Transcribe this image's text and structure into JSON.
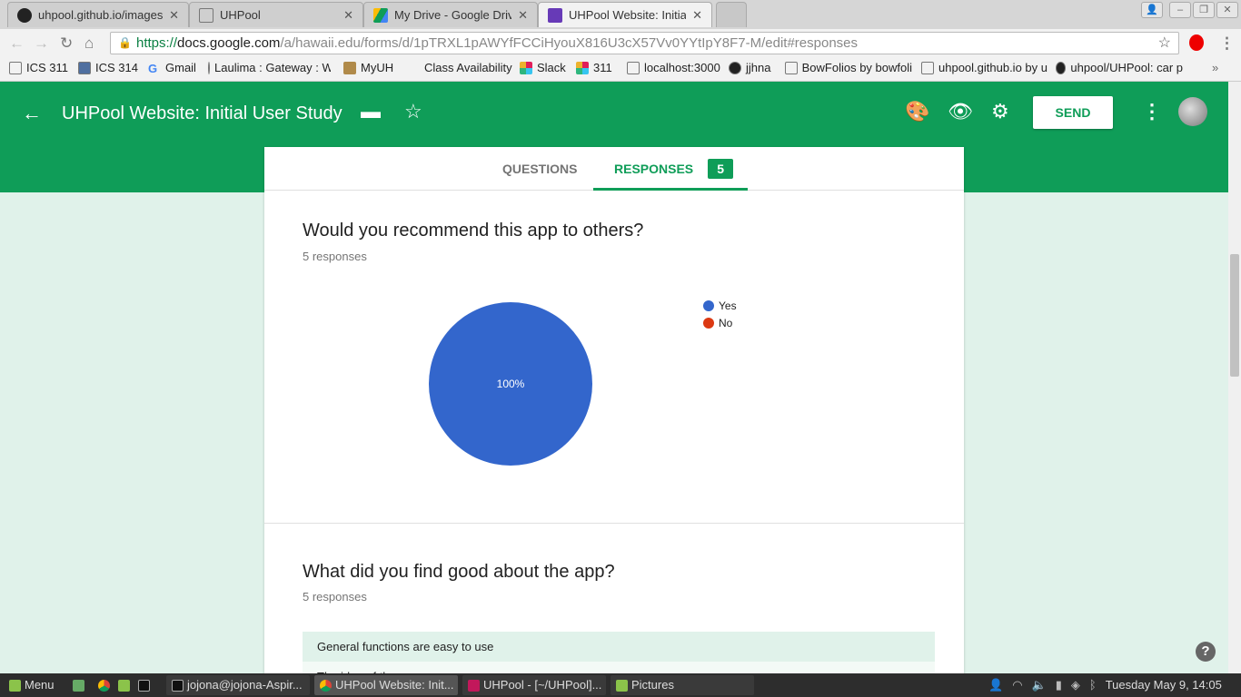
{
  "browser": {
    "tabs": [
      {
        "title": "uhpool.github.io/images",
        "icon": "github-icon"
      },
      {
        "title": "UHPool",
        "icon": "page-icon"
      },
      {
        "title": "My Drive - Google Drive",
        "icon": "drive-icon"
      },
      {
        "title": "UHPool Website: Initial User Study",
        "icon": "forms-icon"
      }
    ],
    "url_scheme": "https://",
    "url_domain": "docs.google.com",
    "url_path": "/a/hawaii.edu/forms/d/1pTRXL1pAWYfFCCiHyouX816U3cX57Vv0YYtIpY8F7-M/edit#responses",
    "bookmarks": [
      "ICS 311",
      "ICS 314",
      "Gmail",
      "Laulima : Gateway : W",
      "MyUH",
      "Class Availability",
      "Slack",
      "311",
      "localhost:3000",
      "jjhna",
      "BowFolios by bowfoli",
      "uhpool.github.io by u",
      "uhpool/UHPool: car p"
    ],
    "more": "»"
  },
  "form": {
    "title": "UHPool Website: Initial User Study",
    "send_label": "SEND",
    "tabs": {
      "questions": "QUESTIONS",
      "responses": "RESPONSES",
      "response_count": "5"
    }
  },
  "questions": [
    {
      "title": "Would you recommend this app to others?",
      "count": "5 responses"
    },
    {
      "title": "What did you find good about the app?",
      "count": "5 responses",
      "answers": [
        "General functions are easy to use",
        "The idea of th"
      ]
    }
  ],
  "chart_data": {
    "type": "pie",
    "categories": [
      "Yes",
      "No"
    ],
    "values": [
      100,
      0
    ],
    "labels": [
      "100%"
    ],
    "colors": [
      "#3366cc",
      "#dc3912"
    ],
    "legend": "right"
  },
  "taskbar": {
    "menu": "Menu",
    "windows": [
      "jojona@jojona-Aspir...",
      "UHPool Website: Init...",
      "UHPool - [~/UHPool]...",
      "Pictures"
    ],
    "clock": "Tuesday May  9, 14:05"
  },
  "help": "?"
}
